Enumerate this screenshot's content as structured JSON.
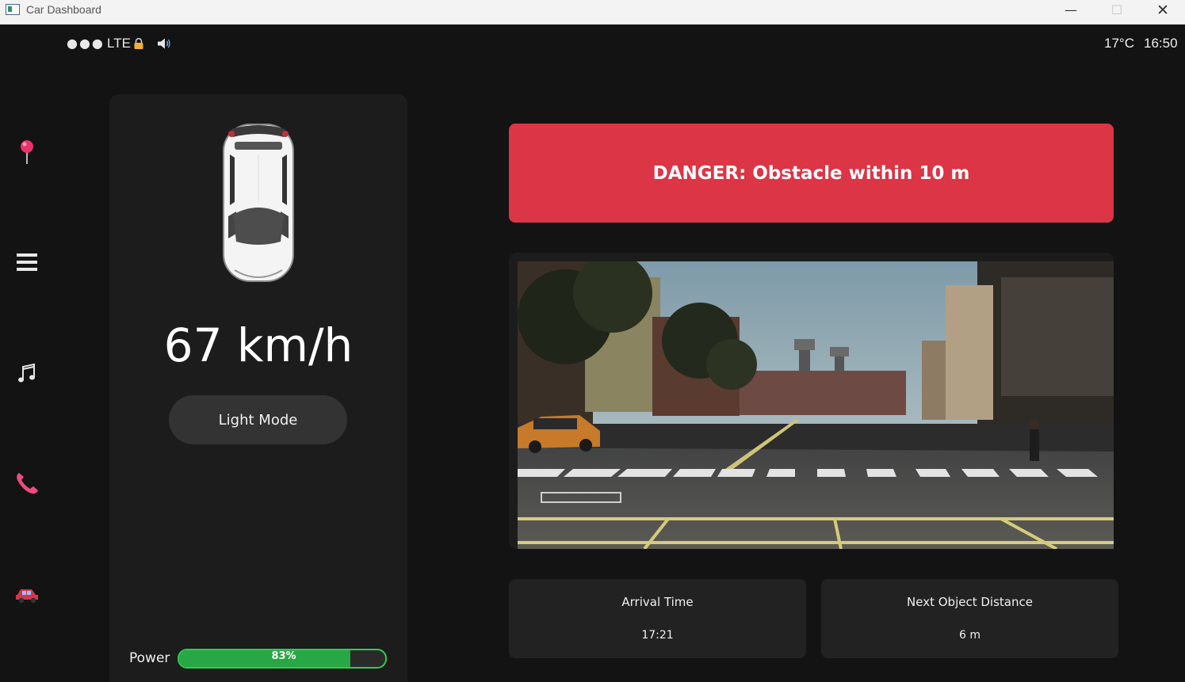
{
  "window": {
    "title": "Car Dashboard",
    "minimize": "—",
    "maximize": "☐",
    "close": "✕"
  },
  "status": {
    "signal": "●●●",
    "network": "LTE",
    "temperature": "17°C",
    "time": "16:50"
  },
  "nav": [
    "map",
    "menu",
    "music",
    "phone",
    "vehicle"
  ],
  "vehicle": {
    "speed": "67 km/h",
    "mode_button": "Light Mode"
  },
  "power": {
    "label": "Power",
    "percent_text": "83%",
    "level": 0.83
  },
  "alert": {
    "text": "DANGER: Obstacle within 10 m",
    "color": "#dc3545"
  },
  "cards": {
    "arrival": {
      "title": "Arrival Time",
      "value": "17:21"
    },
    "distance": {
      "title": "Next Object Distance",
      "value": "6 m"
    }
  },
  "colors": {
    "accent_green": "#28a745",
    "background": "#131313",
    "panel": "#1c1c1c"
  }
}
